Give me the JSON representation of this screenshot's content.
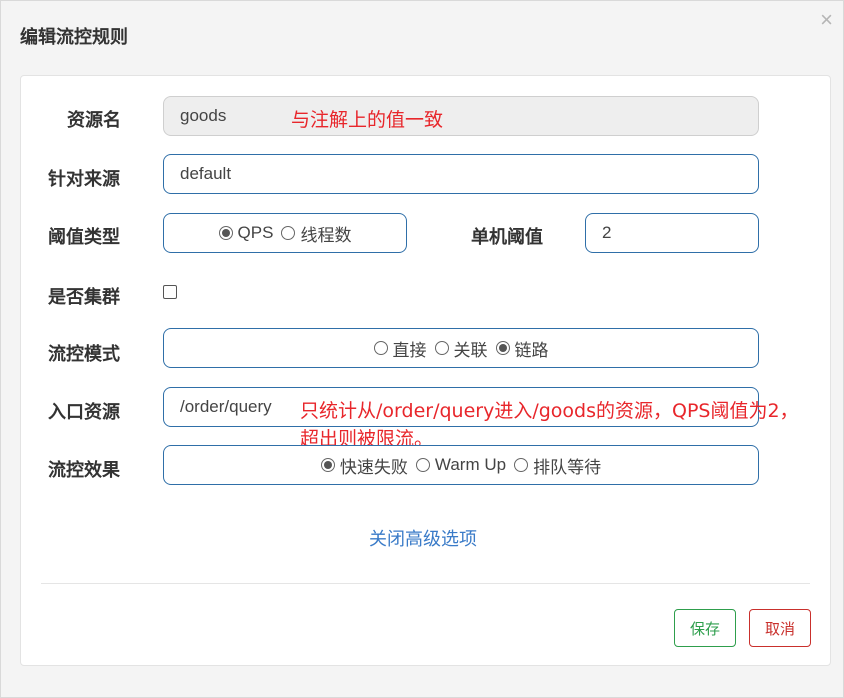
{
  "dialog": {
    "title": "编辑流控规则",
    "close": "×"
  },
  "form": {
    "resource": {
      "label": "资源名",
      "value": "goods"
    },
    "limit_app": {
      "label": "针对来源",
      "value": "default"
    },
    "threshold_type": {
      "label": "阈值类型",
      "options": [
        "QPS",
        "线程数"
      ],
      "selected": "QPS"
    },
    "threshold": {
      "label": "单机阈值",
      "value": "2"
    },
    "cluster": {
      "label": "是否集群",
      "checked": false
    },
    "strategy": {
      "label": "流控模式",
      "options": [
        "直接",
        "关联",
        "链路"
      ],
      "selected": "链路"
    },
    "ref_resource": {
      "label": "入口资源",
      "value": "/order/query"
    },
    "control_behavior": {
      "label": "流控效果",
      "options": [
        "快速失败",
        "Warm Up",
        "排队等待"
      ],
      "selected": "快速失败"
    },
    "toggle_advanced": "关闭高级选项"
  },
  "annotations": {
    "resource_note": "与注解上的值一致",
    "ref_note_line1": "只统计从/order/query进入/goods的资源，QPS阈值为2，",
    "ref_note_line2": "超出则被限流。"
  },
  "buttons": {
    "save": "保存",
    "cancel": "取消"
  }
}
